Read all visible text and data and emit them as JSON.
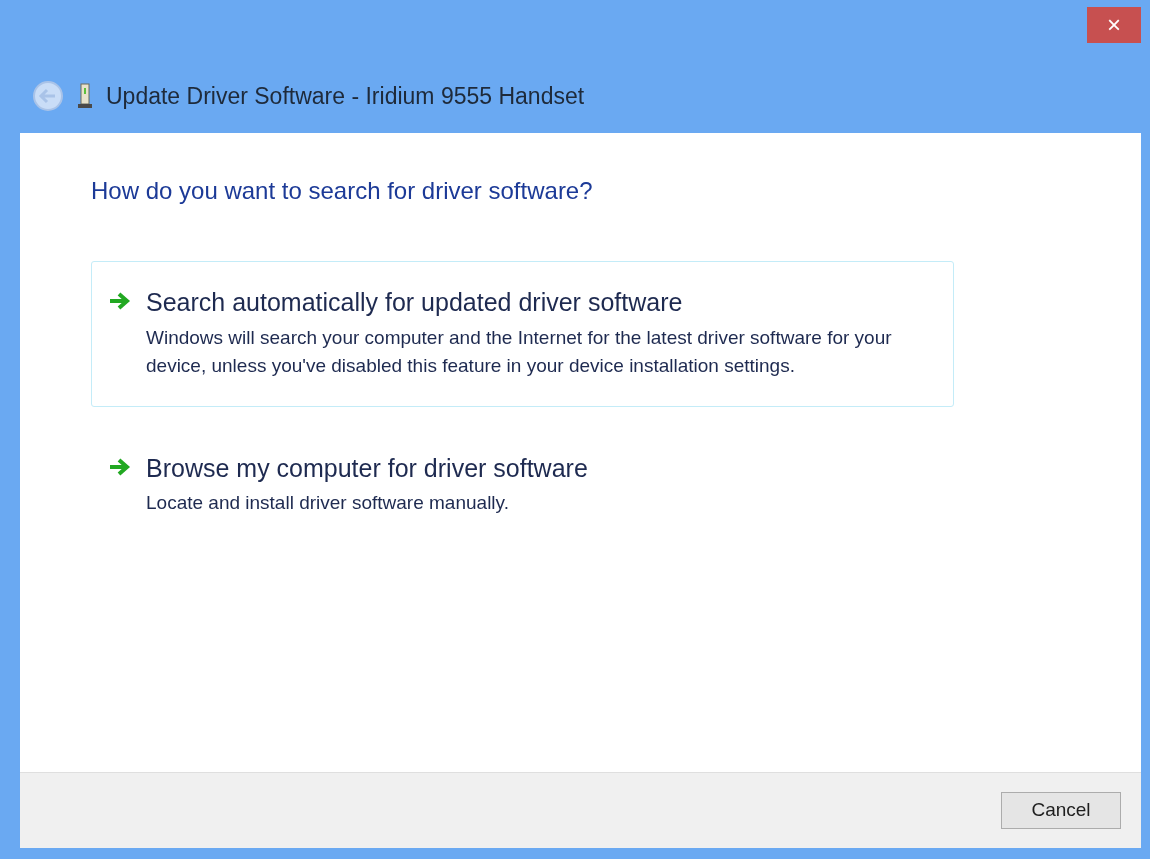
{
  "window": {
    "title": "Update Driver Software - Iridium 9555 Handset",
    "close": "×"
  },
  "heading": "How do you want to search for driver software?",
  "options": [
    {
      "title": "Search automatically for updated driver software",
      "description": "Windows will search your computer and the Internet for the latest driver software for your device, unless you've disabled this feature in your device installation settings.",
      "selected": true
    },
    {
      "title": "Browse my computer for driver software",
      "description": "Locate and install driver software manually.",
      "selected": false
    }
  ],
  "buttons": [
    "Cancel"
  ]
}
